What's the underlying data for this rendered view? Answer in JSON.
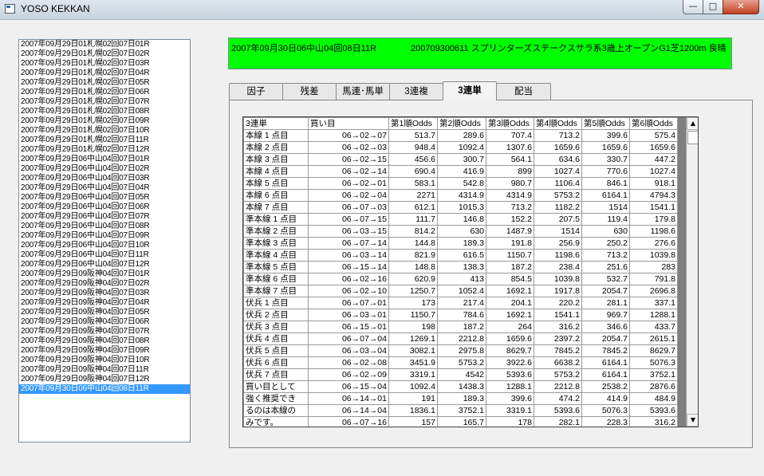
{
  "window": {
    "title": "YOSO KEKKAN",
    "min_label": "—",
    "max_label": "□",
    "close_label": "✕"
  },
  "races": [
    "2007年09月29日01札幌02回07日01R",
    "2007年09月29日01札幌02回07日02R",
    "2007年09月29日01札幌02回07日03R",
    "2007年09月29日01札幌02回07日04R",
    "2007年09月29日01札幌02回07日05R",
    "2007年09月29日01札幌02回07日06R",
    "2007年09月29日01札幌02回07日07R",
    "2007年09月29日01札幌02回07日08R",
    "2007年09月29日01札幌02回07日09R",
    "2007年09月29日01札幌02回07日10R",
    "2007年09月29日01札幌02回07日11R",
    "2007年09月29日01札幌02回07日12R",
    "2007年09月29日06中山04回07日01R",
    "2007年09月29日06中山04回07日02R",
    "2007年09月29日06中山04回07日03R",
    "2007年09月29日06中山04回07日04R",
    "2007年09月29日06中山04回07日05R",
    "2007年09月29日06中山04回07日06R",
    "2007年09月29日06中山04回07日07R",
    "2007年09月29日06中山04回07日08R",
    "2007年09月29日06中山04回07日09R",
    "2007年09月29日06中山04回07日10R",
    "2007年09月29日06中山04回07日11R",
    "2007年09月29日06中山04回07日12R",
    "2007年09月29日09阪神04回07日01R",
    "2007年09月29日09阪神04回07日02R",
    "2007年09月29日09阪神04回07日03R",
    "2007年09月29日09阪神04回07日04R",
    "2007年09月29日09阪神04回07日05R",
    "2007年09月29日09阪神04回07日06R",
    "2007年09月29日09阪神04回07日07R",
    "2007年09月29日09阪神04回07日08R",
    "2007年09月29日09阪神04回07日09R",
    "2007年09月29日09阪神04回07日10R",
    "2007年09月29日09阪神04回07日11R",
    "2007年09月29日09阪神04回07日12R",
    "2007年09月30日06中山04回08日11R"
  ],
  "selected_race_index": 36,
  "header": {
    "race": "2007年09月30日06中山04回08日11R",
    "info": "200709300611 スプリンターズステークスサラ系3歳上オープンG1芝1200m 良晴",
    "color": "#00ff00"
  },
  "tabs": [
    {
      "label": "因子",
      "active": false
    },
    {
      "label": "残差",
      "active": false
    },
    {
      "label": "馬連･馬単",
      "active": false
    },
    {
      "label": "3連複",
      "active": false
    },
    {
      "label": "3連単",
      "active": true
    },
    {
      "label": "配当",
      "active": false
    }
  ],
  "grid": {
    "columns": [
      "3連単",
      "買い目",
      "第1順Odds",
      "第2順Odds",
      "第3順Odds",
      "第4順Odds",
      "第5順Odds",
      "第6順Odds"
    ],
    "rows": [
      [
        "本線 1 点目",
        "06→02→07",
        "513.7",
        "289.6",
        "707.4",
        "713.2",
        "399.6",
        "575.4"
      ],
      [
        "本線 2 点目",
        "06→02→03",
        "948.4",
        "1092.4",
        "1307.6",
        "1659.6",
        "1659.6",
        "1659.6"
      ],
      [
        "本線 3 点目",
        "06→02→15",
        "456.6",
        "300.7",
        "564.1",
        "634.6",
        "330.7",
        "447.2"
      ],
      [
        "本線 4 点目",
        "06→02→14",
        "690.4",
        "416.9",
        "899",
        "1027.4",
        "770.6",
        "1027.4"
      ],
      [
        "本線 5 点目",
        "06→02→01",
        "583.1",
        "542.8",
        "980.7",
        "1106.4",
        "846.1",
        "918.1"
      ],
      [
        "本線 6 点目",
        "06→02→04",
        "2271",
        "4314.9",
        "4314.9",
        "5753.2",
        "6164.1",
        "4794.3"
      ],
      [
        "本線 7 点目",
        "06→07→03",
        "612.1",
        "1015.3",
        "713.2",
        "1182.2",
        "1514",
        "1541.1"
      ],
      [
        "準本線 1 点目",
        "06→07→15",
        "111.7",
        "146.8",
        "152.2",
        "207.5",
        "119.4",
        "179.8"
      ],
      [
        "準本線 2 点目",
        "06→03→15",
        "814.2",
        "630",
        "1487.9",
        "1514",
        "630",
        "1198.6"
      ],
      [
        "準本線 3 点目",
        "06→07→14",
        "144.8",
        "189.3",
        "191.8",
        "256.9",
        "250.2",
        "276.6"
      ],
      [
        "準本線 4 点目",
        "06→03→14",
        "821.9",
        "616.5",
        "1150.7",
        "1198.6",
        "713.2",
        "1039.8"
      ],
      [
        "準本線 5 点目",
        "06→15→14",
        "148.8",
        "138.3",
        "187.2",
        "238.4",
        "251.6",
        "283"
      ],
      [
        "準本線 6 点目",
        "06→02→16",
        "620.9",
        "413",
        "854.5",
        "1039.8",
        "532.7",
        "791.8"
      ],
      [
        "準本線 7 点目",
        "06→02→10",
        "1250.7",
        "1052.4",
        "1692.1",
        "1917.8",
        "2054.7",
        "2696.8"
      ],
      [
        "伏兵 1 点目",
        "06→07→01",
        "173",
        "217.4",
        "204.1",
        "220.2",
        "281.1",
        "337.1"
      ],
      [
        "伏兵 2 点目",
        "06→03→01",
        "1150.7",
        "784.6",
        "1692.1",
        "1541.1",
        "969.7",
        "1288.1"
      ],
      [
        "伏兵 3 点目",
        "06→15→01",
        "198",
        "187.2",
        "264",
        "316.2",
        "346.6",
        "433.7"
      ],
      [
        "伏兵 4 点目",
        "06→07→04",
        "1269.1",
        "2212.8",
        "1659.6",
        "2397.2",
        "2054.7",
        "2615.1"
      ],
      [
        "伏兵 5 点目",
        "06→03→04",
        "3082.1",
        "2975.8",
        "8629.7",
        "7845.2",
        "7845.2",
        "8629.7"
      ],
      [
        "伏兵 6 点目",
        "06→02→08",
        "3451.9",
        "5753.2",
        "3922.6",
        "6638.2",
        "6164.1",
        "5076.3"
      ],
      [
        "伏兵 7 点目",
        "06→02→09",
        "3319.1",
        "4542",
        "5393.6",
        "5753.2",
        "6164.1",
        "3752.1"
      ],
      [
        "買い目として",
        "06→15→04",
        "1092.4",
        "1438.3",
        "1288.1",
        "2212.8",
        "2538.2",
        "2876.6"
      ],
      [
        "強く推奨でき",
        "06→14→01",
        "191",
        "189.3",
        "399.6",
        "474.2",
        "414.9",
        "484.9"
      ],
      [
        "るのは本線の",
        "06→14→04",
        "1836.1",
        "3752.1",
        "3319.1",
        "5393.6",
        "5076.3",
        "5393.6"
      ],
      [
        "みです。",
        "06→07→16",
        "157",
        "165.7",
        "178",
        "282.1",
        "228.3",
        "316.2"
      ]
    ]
  },
  "scrollbar": {
    "up_label": "▲",
    "down_label": "▼"
  }
}
